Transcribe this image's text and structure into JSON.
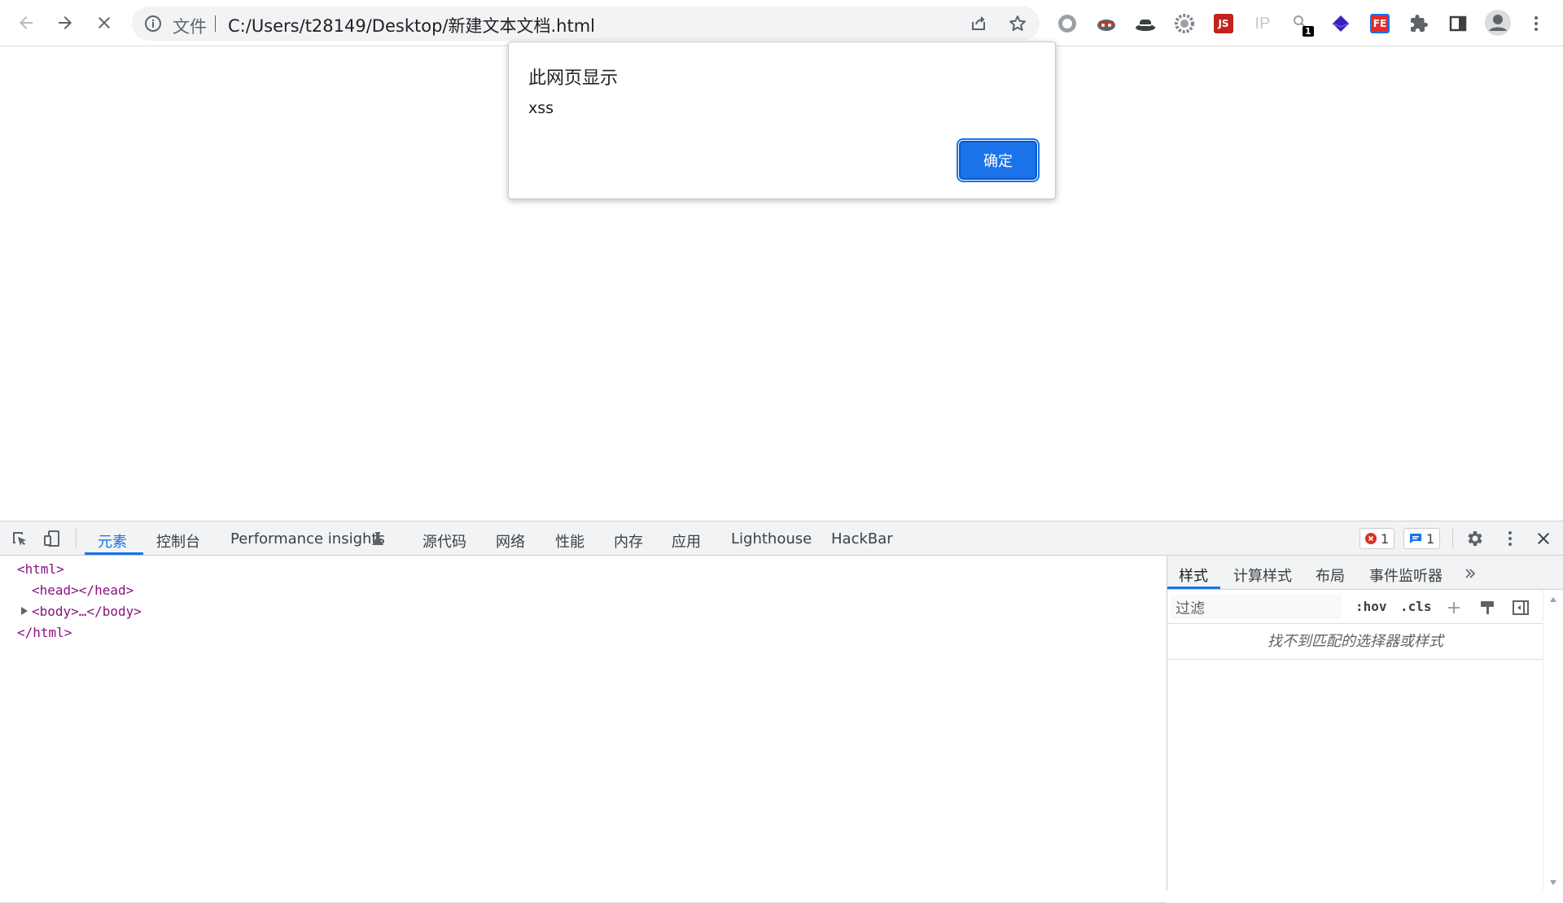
{
  "browser": {
    "omnibox": {
      "scheme_label": "文件",
      "url": "C:/Users/t28149/Desktop/新建文本文档.html"
    },
    "extensions": [
      {
        "name": "record-icon"
      },
      {
        "name": "mask-icon"
      },
      {
        "name": "hat-icon"
      },
      {
        "name": "gear-extension-icon"
      },
      {
        "name": "js-extension-icon",
        "label": "JS"
      },
      {
        "name": "ip-extension-icon",
        "label": "IP"
      },
      {
        "name": "key-extension-icon",
        "badge": "1"
      },
      {
        "name": "stack-extension-icon"
      },
      {
        "name": "fe-extension-icon",
        "label": "FE"
      }
    ]
  },
  "dialog": {
    "title": "此网页显示",
    "message": "xss",
    "ok_label": "确定"
  },
  "devtools": {
    "tabs": [
      {
        "label": "元素"
      },
      {
        "label": "控制台"
      },
      {
        "label": "Performance insights"
      },
      {
        "label": "源代码"
      },
      {
        "label": "网络"
      },
      {
        "label": "性能"
      },
      {
        "label": "内存"
      },
      {
        "label": "应用"
      },
      {
        "label": "Lighthouse"
      },
      {
        "label": "HackBar"
      }
    ],
    "error_count": "1",
    "message_count": "1",
    "elements": {
      "lines": [
        "<html>",
        "<head></head>",
        "<body>…</body>",
        "</html>"
      ]
    },
    "styles": {
      "tabs": [
        {
          "label": "样式"
        },
        {
          "label": "计算样式"
        },
        {
          "label": "布局"
        },
        {
          "label": "事件监听器"
        }
      ],
      "filter_placeholder": "过滤",
      "hov_label": ":hov",
      "cls_label": ".cls",
      "empty_message": "找不到匹配的选择器或样式"
    }
  },
  "colors": {
    "accent": "#1a73e8",
    "error": "#d93025",
    "tag": "#881280"
  }
}
